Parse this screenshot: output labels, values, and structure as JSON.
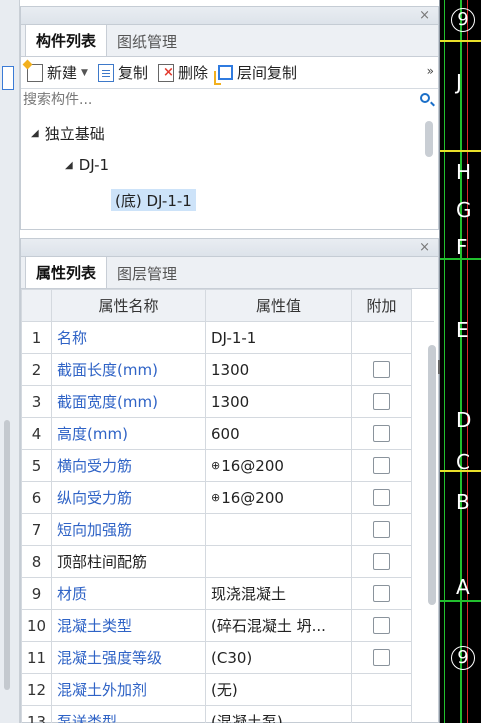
{
  "component_panel": {
    "close_glyph": "×",
    "tabs": [
      {
        "label": "构件列表",
        "active": true
      },
      {
        "label": "图纸管理",
        "active": false
      }
    ],
    "toolbar": {
      "new_label": "新建",
      "copy_label": "复制",
      "delete_label": "删除",
      "floor_copy_label": "层间复制",
      "more_glyph": "»"
    },
    "search": {
      "placeholder": "搜索构件..."
    },
    "tree": [
      {
        "label": "独立基础",
        "level": 0,
        "expanded": true
      },
      {
        "label": "DJ-1",
        "level": 1,
        "expanded": true
      },
      {
        "label": "(底) DJ-1-1",
        "level": 2,
        "selected": true
      }
    ]
  },
  "property_panel": {
    "close_glyph": "×",
    "tabs": [
      {
        "label": "属性列表",
        "active": true
      },
      {
        "label": "图层管理",
        "active": false
      }
    ],
    "columns": [
      "属性名称",
      "属性值",
      "附加"
    ],
    "rows": [
      {
        "num": "1",
        "name": "名称",
        "value": "DJ-1-1",
        "blue": true,
        "checkbox": false
      },
      {
        "num": "2",
        "name": "截面长度(mm)",
        "value": "1300",
        "blue": true,
        "checkbox": true
      },
      {
        "num": "3",
        "name": "截面宽度(mm)",
        "value": "1300",
        "blue": true,
        "checkbox": true
      },
      {
        "num": "4",
        "name": "高度(mm)",
        "value": "600",
        "blue": true,
        "checkbox": true
      },
      {
        "num": "5",
        "name": "横向受力筋",
        "value": "16@200",
        "rebar_symbol": "⊕",
        "blue": true,
        "checkbox": true
      },
      {
        "num": "6",
        "name": "纵向受力筋",
        "value": "16@200",
        "rebar_symbol": "⊕",
        "blue": true,
        "checkbox": true
      },
      {
        "num": "7",
        "name": "短向加强筋",
        "value": "",
        "blue": true,
        "checkbox": true
      },
      {
        "num": "8",
        "name": "顶部柱间配筋",
        "value": "",
        "blue": false,
        "checkbox": true
      },
      {
        "num": "9",
        "name": "材质",
        "value": "现浇混凝土",
        "blue": true,
        "checkbox": true
      },
      {
        "num": "10",
        "name": "混凝土类型",
        "value": "(碎石混凝土 坍...",
        "blue": true,
        "checkbox": true
      },
      {
        "num": "11",
        "name": "混凝土强度等级",
        "value": "(C30)",
        "blue": true,
        "checkbox": true
      },
      {
        "num": "12",
        "name": "混凝土外加剂",
        "value": "(无)",
        "blue": true,
        "checkbox": false
      },
      {
        "num": "13",
        "name": "泵送类型",
        "value": "(混凝土泵)",
        "blue": true,
        "checkbox": false
      }
    ]
  },
  "cad_view": {
    "axis_labels": [
      "9",
      "J",
      "H",
      "G",
      "F",
      "E",
      "D",
      "C",
      "B",
      "A",
      "9"
    ],
    "colors": {
      "background": "#000000",
      "green": "#22c02e",
      "red": "#d9262a",
      "yellow": "#e8e02a"
    }
  }
}
